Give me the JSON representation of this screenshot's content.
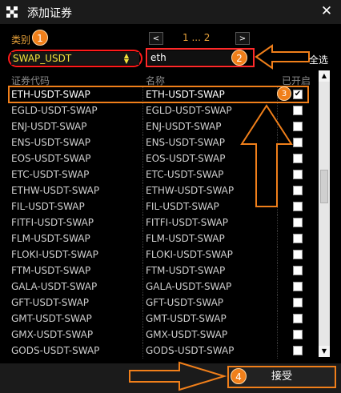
{
  "window": {
    "title": "添加证券",
    "close_glyph": "✕"
  },
  "filters": {
    "category_label": "类别",
    "category_value": "SWAP_USDT",
    "search_value": "eth",
    "select_all_label": "全选"
  },
  "pager": {
    "prev": "<",
    "text": "1 ... 2",
    "next": ">"
  },
  "table": {
    "headers": {
      "code": "证券代码",
      "name": "名称",
      "enabled": "已开启"
    },
    "rows": [
      {
        "code": "ETH-USDT-SWAP",
        "name": "ETH-USDT-SWAP",
        "checked": true
      },
      {
        "code": "EGLD-USDT-SWAP",
        "name": "EGLD-USDT-SWAP",
        "checked": false
      },
      {
        "code": "ENJ-USDT-SWAP",
        "name": "ENJ-USDT-SWAP",
        "checked": false
      },
      {
        "code": "ENS-USDT-SWAP",
        "name": "ENS-USDT-SWAP",
        "checked": false
      },
      {
        "code": "EOS-USDT-SWAP",
        "name": "EOS-USDT-SWAP",
        "checked": false
      },
      {
        "code": "ETC-USDT-SWAP",
        "name": "ETC-USDT-SWAP",
        "checked": false
      },
      {
        "code": "ETHW-USDT-SWAP",
        "name": "ETHW-USDT-SWAP",
        "checked": false
      },
      {
        "code": "FIL-USDT-SWAP",
        "name": "FIL-USDT-SWAP",
        "checked": false
      },
      {
        "code": "FITFI-USDT-SWAP",
        "name": "FITFI-USDT-SWAP",
        "checked": false
      },
      {
        "code": "FLM-USDT-SWAP",
        "name": "FLM-USDT-SWAP",
        "checked": false
      },
      {
        "code": "FLOKI-USDT-SWAP",
        "name": "FLOKI-USDT-SWAP",
        "checked": false
      },
      {
        "code": "FTM-USDT-SWAP",
        "name": "FTM-USDT-SWAP",
        "checked": false
      },
      {
        "code": "GALA-USDT-SWAP",
        "name": "GALA-USDT-SWAP",
        "checked": false
      },
      {
        "code": "GFT-USDT-SWAP",
        "name": "GFT-USDT-SWAP",
        "checked": false
      },
      {
        "code": "GMT-USDT-SWAP",
        "name": "GMT-USDT-SWAP",
        "checked": false
      },
      {
        "code": "GMX-USDT-SWAP",
        "name": "GMX-USDT-SWAP",
        "checked": false
      },
      {
        "code": "GODS-USDT-SWAP",
        "name": "GODS-USDT-SWAP",
        "checked": false
      }
    ]
  },
  "buttons": {
    "accept": "接受"
  },
  "annotations": {
    "badges": [
      "1",
      "2",
      "3",
      "4"
    ],
    "color": "#f07f1a"
  },
  "icons": {
    "app": "app-logo-icon",
    "close": "close-icon",
    "dropdown": "dropdown-arrows-icon",
    "scroll_up": "scroll-up-icon",
    "scroll_down": "scroll-down-icon"
  }
}
